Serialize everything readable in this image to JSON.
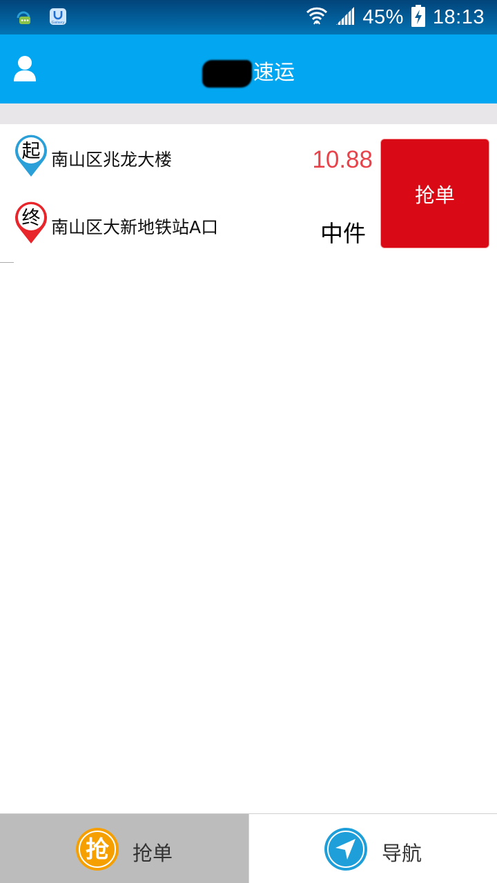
{
  "status_bar": {
    "left_icons": [
      "chat-app-icon",
      "galaxy-app-icon"
    ],
    "galaxy_text": "Galaxy",
    "right_icons": [
      "wifi-icon",
      "signal-icon",
      "battery-charging-icon"
    ],
    "battery": "45%",
    "time": "18:13"
  },
  "header": {
    "title": "速运",
    "user_icon": "user-icon"
  },
  "order": {
    "start_badge": "起",
    "start_address": "南山区兆龙大楼",
    "end_badge": "终",
    "end_address": "南山区大新地铁站A口",
    "price": "10.88",
    "size": "中件",
    "grab_button": "抢单"
  },
  "bottom_nav": {
    "grab_icon_text": "抢",
    "grab_label": "抢单",
    "navigate_label": "导航"
  },
  "colors": {
    "header": "#03a6f0",
    "grab_button": "#d90a15",
    "price": "#e8434b",
    "start_pin": "#2a9fd8",
    "end_pin": "#e8252a"
  }
}
